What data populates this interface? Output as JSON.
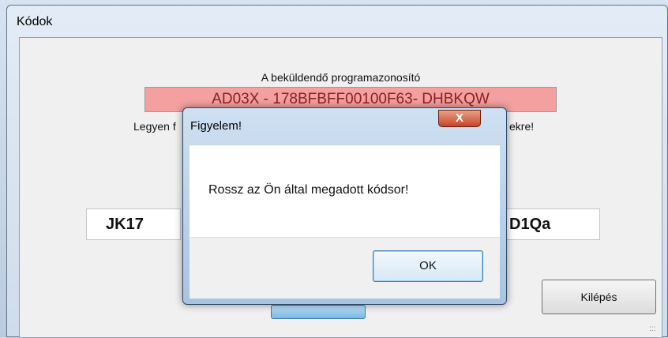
{
  "main_window": {
    "title": "Kódok",
    "caption": "A beküldendő programazonosító",
    "program_code": "AD03X - 178BFBFF00100F63- DHBKQW",
    "hint_left": "Legyen f",
    "hint_right": "ekre!",
    "code_left": "JK17",
    "code_right": "D1Qa",
    "exit_label": "Kilépés",
    "grip": ":::"
  },
  "dialog": {
    "title": "Figyelem!",
    "close_glyph": "X",
    "message": "Rossz az Ön által megadott kódsor!",
    "ok_label": "OK"
  }
}
